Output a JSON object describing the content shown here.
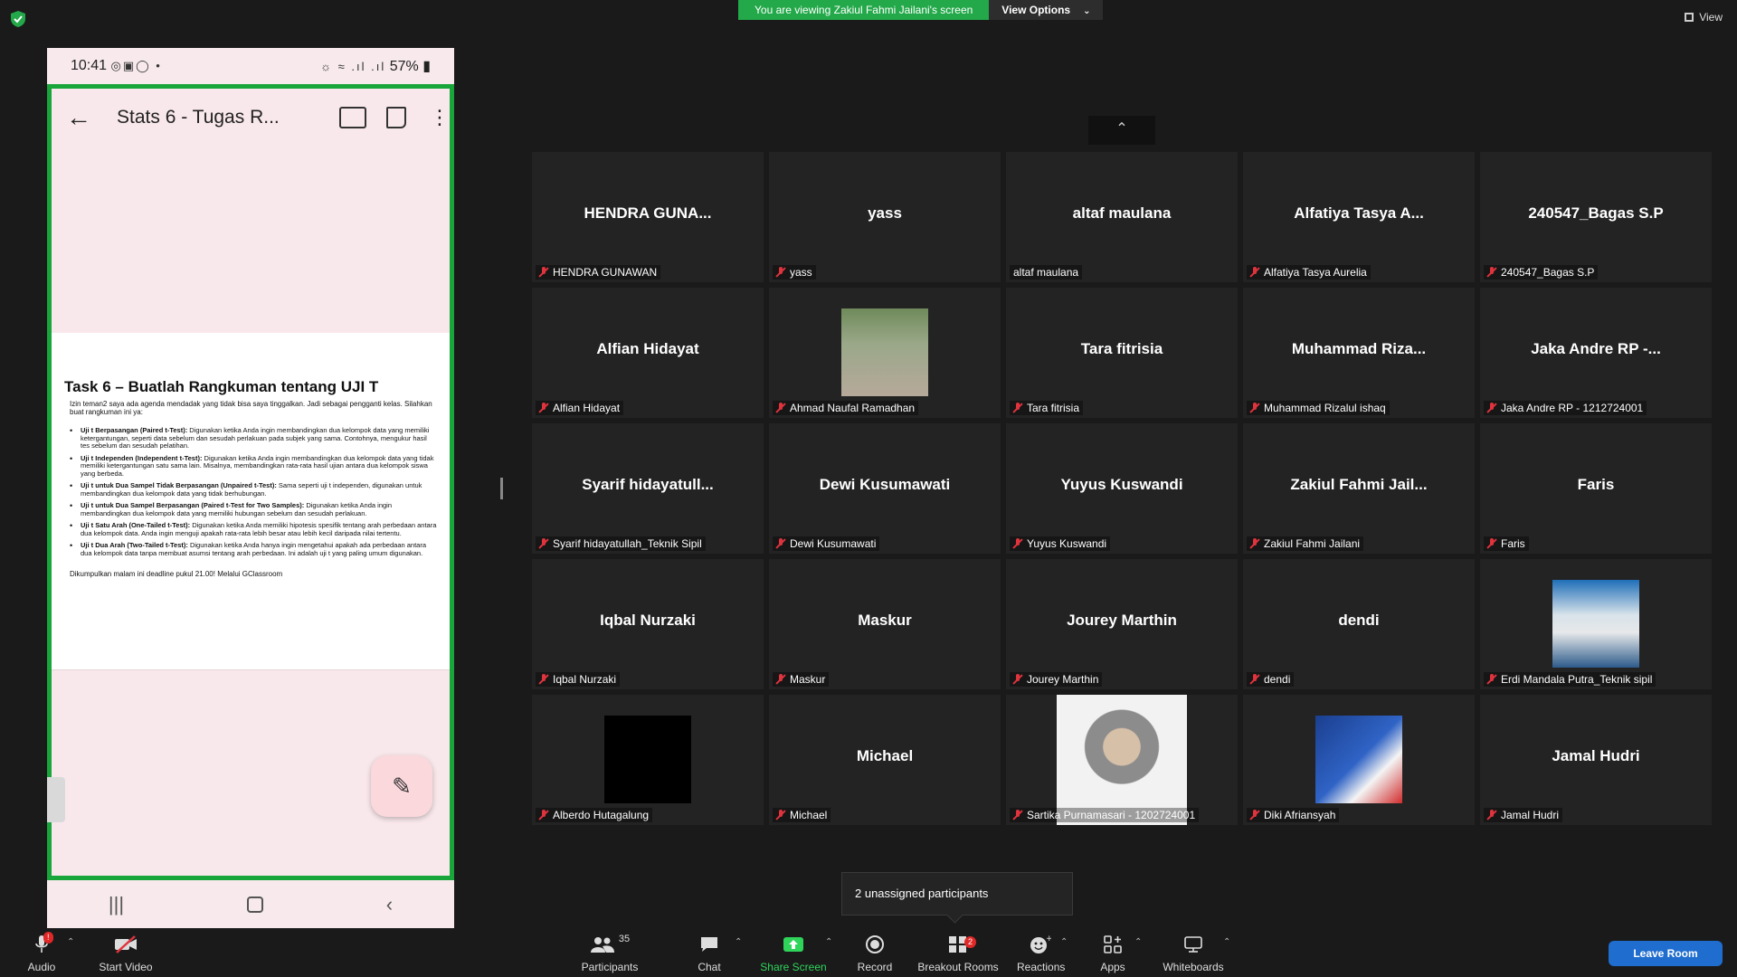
{
  "banner": {
    "viewing": "You are viewing Zakiul Fahmi Jailani's screen",
    "view_options": "View Options",
    "view": "View"
  },
  "phone": {
    "time": "10:41",
    "battery": "57%",
    "app_title": "Stats 6 - Tugas R...",
    "doc": {
      "heading": "Task 6 – Buatlah Rangkuman tentang UJI T",
      "intro": "Izin teman2 saya ada agenda mendadak yang tidak bisa saya tinggalkan. Jadi sebagai pengganti kelas. Silahkan buat rangkuman ini ya:",
      "items": [
        {
          "term": "Uji t Berpasangan (Paired t-Test):",
          "desc": " Digunakan ketika Anda ingin membandingkan dua kelompok data yang memiliki ketergantungan, seperti data sebelum dan sesudah perlakuan pada subjek yang sama. Contohnya, mengukur hasil tes sebelum dan sesudah pelatihan."
        },
        {
          "term": "Uji t Independen (Independent t-Test):",
          "desc": " Digunakan ketika Anda ingin membandingkan dua kelompok data yang tidak memiliki ketergantungan satu sama lain. Misalnya, membandingkan rata-rata hasil ujian antara dua kelompok siswa yang berbeda."
        },
        {
          "term": "Uji t untuk Dua Sampel Tidak Berpasangan (Unpaired t-Test):",
          "desc": " Sama seperti uji t independen, digunakan untuk membandingkan dua kelompok data yang tidak berhubungan."
        },
        {
          "term": "Uji t untuk Dua Sampel Berpasangan (Paired t-Test for Two Samples):",
          "desc": " Digunakan ketika Anda ingin membandingkan dua kelompok data yang memiliki hubungan sebelum dan sesudah perlakuan."
        },
        {
          "term": "Uji t Satu Arah (One-Tailed t-Test):",
          "desc": " Digunakan ketika Anda memiliki hipotesis spesifik tentang arah perbedaan antara dua kelompok data. Anda ingin menguji apakah rata-rata lebih besar atau lebih kecil daripada nilai tertentu."
        },
        {
          "term": "Uji t Dua Arah (Two-Tailed t-Test):",
          "desc": " Digunakan ketika Anda hanya ingin mengetahui apakah ada perbedaan antara dua kelompok data tanpa membuat asumsi tentang arah perbedaan. Ini adalah uji t yang paling umum digunakan."
        }
      ],
      "footer": "Dikumpulkan malam ini deadline pukul 21.00! Melalui GClassroom"
    }
  },
  "participants": [
    {
      "big": "HENDRA  GUNA...",
      "name": "HENDRA GUNAWAN",
      "muted": true
    },
    {
      "big": "yass",
      "name": "yass",
      "muted": true
    },
    {
      "big": "altaf maulana",
      "name": "altaf maulana",
      "muted": false
    },
    {
      "big": "Alfatiya Tasya A...",
      "name": "Alfatiya Tasya Aurelia",
      "muted": true
    },
    {
      "big": "240547_Bagas S.P",
      "name": "240547_Bagas S.P",
      "muted": true
    },
    {
      "big": "Alfian Hidayat",
      "name": "Alfian Hidayat",
      "muted": true
    },
    {
      "big": "",
      "name": "Ahmad Naufal Ramadhan",
      "muted": true,
      "photo": "man"
    },
    {
      "big": "Tara fitrisia",
      "name": "Tara fitrisia",
      "muted": true
    },
    {
      "big": "Muhammad  Riza...",
      "name": "Muhammad Rizalul ishaq",
      "muted": true
    },
    {
      "big": "Jaka Andre RP -...",
      "name": "Jaka Andre RP - 1212724001",
      "muted": true
    },
    {
      "big": "Syarif  hidayatull...",
      "name": "Syarif hidayatullah_Teknik Sipil",
      "muted": true
    },
    {
      "big": "Dewi Kusumawati",
      "name": "Dewi Kusumawati",
      "muted": true
    },
    {
      "big": "Yuyus Kuswandi",
      "name": "Yuyus Kuswandi",
      "muted": true
    },
    {
      "big": "Zakiul  Fahmi  Jail...",
      "name": "Zakiul Fahmi Jailani",
      "muted": true
    },
    {
      "big": "Faris",
      "name": "Faris",
      "muted": true
    },
    {
      "big": "Iqbal Nurzaki",
      "name": "Iqbal Nurzaki",
      "muted": true
    },
    {
      "big": "Maskur",
      "name": "Maskur",
      "muted": true
    },
    {
      "big": "Jourey Marthin",
      "name": "Jourey Marthin",
      "muted": true
    },
    {
      "big": "dendi",
      "name": "dendi",
      "muted": true
    },
    {
      "big": "",
      "name": "Erdi Mandala Putra_Teknik sipil",
      "muted": true,
      "photo": "volcano"
    },
    {
      "big": "",
      "name": "Alberdo Hutagalung",
      "muted": true,
      "photo": "black"
    },
    {
      "big": "Michael",
      "name": "Michael",
      "muted": true
    },
    {
      "big": "",
      "name": "Sartika Purnamasari - 1202724001",
      "muted": true,
      "photo": "woman"
    },
    {
      "big": "",
      "name": "Diki Afriansyah",
      "muted": true,
      "photo": "blue"
    },
    {
      "big": "Jamal Hudri",
      "name": "Jamal Hudri",
      "muted": true
    }
  ],
  "tooltip": "2 unassigned participants",
  "toolbar": {
    "audio": "Audio",
    "audio_badge": "!",
    "start_video": "Start Video",
    "participants": "Participants",
    "participants_count": "35",
    "chat": "Chat",
    "share_screen": "Share Screen",
    "record": "Record",
    "breakout_rooms": "Breakout Rooms",
    "breakout_badge": "2",
    "reactions": "Reactions",
    "apps": "Apps",
    "whiteboards": "Whiteboards",
    "leave": "Leave Room"
  },
  "colors": {
    "banner_green": "#23a94a",
    "frame_green": "#18a53a",
    "muted_red": "#e0333d",
    "leave_blue": "#1f6dcf"
  }
}
